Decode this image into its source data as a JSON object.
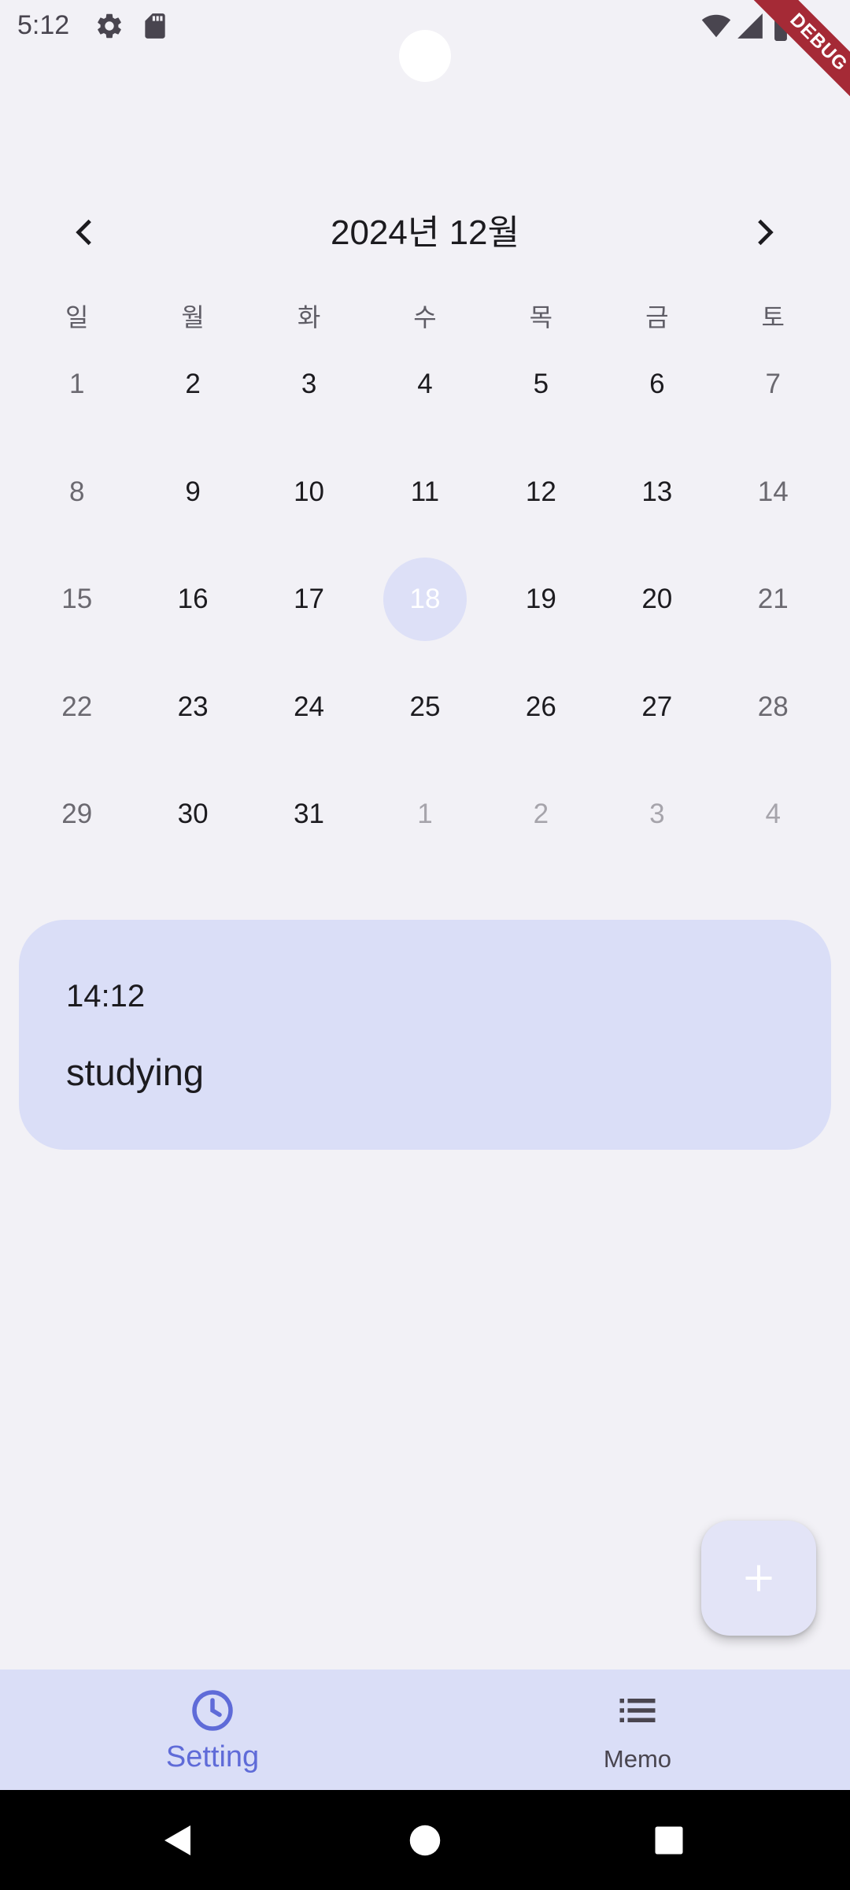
{
  "status_bar": {
    "time": "5:12",
    "debug_label": "DEBUG"
  },
  "calendar": {
    "title": "2024년 12월",
    "weekdays": [
      "일",
      "월",
      "화",
      "수",
      "목",
      "금",
      "토"
    ],
    "days": [
      {
        "n": "1",
        "type": "weekend"
      },
      {
        "n": "2",
        "type": "current"
      },
      {
        "n": "3",
        "type": "current"
      },
      {
        "n": "4",
        "type": "current"
      },
      {
        "n": "5",
        "type": "current"
      },
      {
        "n": "6",
        "type": "current"
      },
      {
        "n": "7",
        "type": "weekend"
      },
      {
        "n": "8",
        "type": "weekend"
      },
      {
        "n": "9",
        "type": "current"
      },
      {
        "n": "10",
        "type": "current"
      },
      {
        "n": "11",
        "type": "current"
      },
      {
        "n": "12",
        "type": "current"
      },
      {
        "n": "13",
        "type": "current"
      },
      {
        "n": "14",
        "type": "weekend"
      },
      {
        "n": "15",
        "type": "weekend"
      },
      {
        "n": "16",
        "type": "current"
      },
      {
        "n": "17",
        "type": "current"
      },
      {
        "n": "18",
        "type": "selected"
      },
      {
        "n": "19",
        "type": "current"
      },
      {
        "n": "20",
        "type": "current"
      },
      {
        "n": "21",
        "type": "weekend"
      },
      {
        "n": "22",
        "type": "weekend"
      },
      {
        "n": "23",
        "type": "current"
      },
      {
        "n": "24",
        "type": "current"
      },
      {
        "n": "25",
        "type": "current"
      },
      {
        "n": "26",
        "type": "current"
      },
      {
        "n": "27",
        "type": "current"
      },
      {
        "n": "28",
        "type": "weekend"
      },
      {
        "n": "29",
        "type": "weekend"
      },
      {
        "n": "30",
        "type": "current"
      },
      {
        "n": "31",
        "type": "current"
      },
      {
        "n": "1",
        "type": "outside"
      },
      {
        "n": "2",
        "type": "outside"
      },
      {
        "n": "3",
        "type": "outside"
      },
      {
        "n": "4",
        "type": "outside"
      }
    ]
  },
  "memo": {
    "time": "14:12",
    "text": "studying"
  },
  "bottom_nav": {
    "items": [
      {
        "label": "Setting",
        "icon": "clock-icon",
        "active": true
      },
      {
        "label": "Memo",
        "icon": "list-icon",
        "active": false
      }
    ]
  },
  "colors": {
    "background": "#f2f1f6",
    "accent": "#5f6bd8",
    "card": "#dadef7",
    "selected_day": "#dde0f7"
  }
}
